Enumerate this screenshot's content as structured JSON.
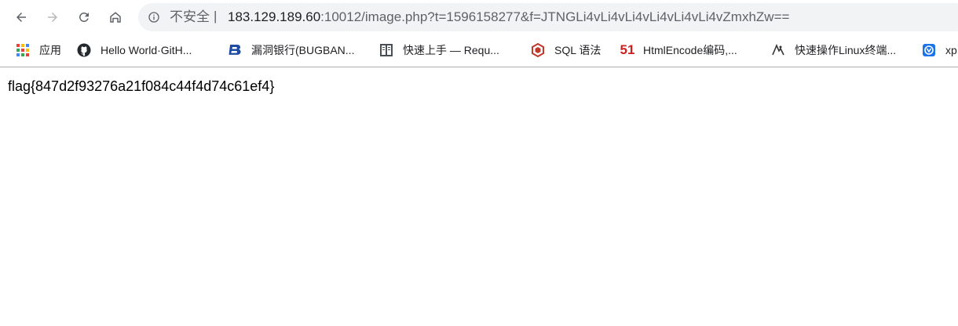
{
  "omnibox": {
    "security_label": "不安全",
    "divider": "|",
    "url_host": "183.129.189.60",
    "url_rest": ":10012/image.php?t=1596158277&f=JTNGLi4vLi4vLi4vLi4vLi4vLi4vZmxhZw=="
  },
  "bookmarks": [
    {
      "label": "应用",
      "icon": "apps-grid-icon"
    },
    {
      "label": "Hello World·GitH...",
      "icon": "github-icon"
    },
    {
      "label": "漏洞银行(BUGBAN...",
      "icon": "bugbank-icon"
    },
    {
      "label": "快速上手 — Requ...",
      "icon": "book-icon"
    },
    {
      "label": "SQL 语法",
      "icon": "sql-icon"
    },
    {
      "label": "HtmlEncode编码,...",
      "icon": "fiftyone-icon",
      "icon_text": "51"
    },
    {
      "label": "快速操作Linux终端...",
      "icon": "linux-icon"
    },
    {
      "label": "xp",
      "icon": "xp-icon"
    }
  ],
  "page": {
    "body_text": "flag{847d2f93276a21f084c44f4d74c61ef4}"
  },
  "colors": {
    "omnibox_bg": "#f1f3f4",
    "github": "#24292e",
    "bugbank": "#1f4ca3",
    "sql": "#c0392b",
    "fiftyone": "#cc1f1f",
    "xp": "#1a73e8"
  }
}
